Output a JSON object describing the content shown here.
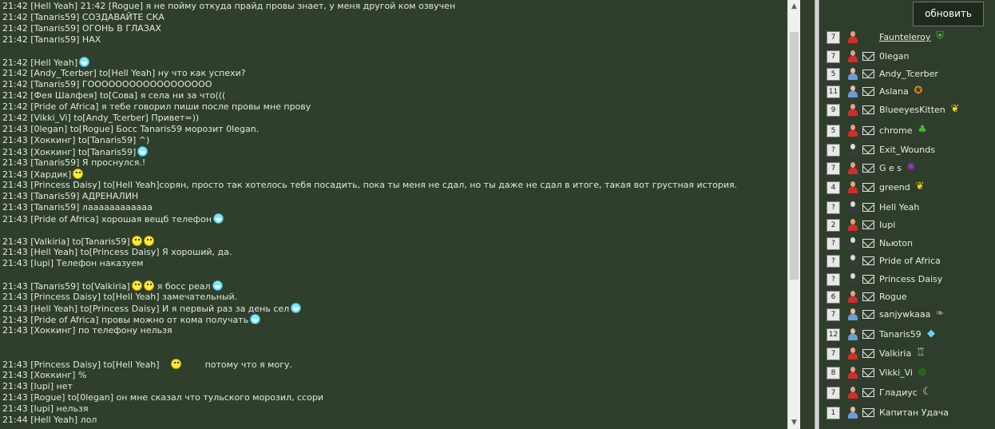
{
  "chat": {
    "lines": [
      {
        "text": "21:42 [Hell Yeah] 21:42 [Rogue] я не пойму откуда прайд провы знает, у меня другой ком озвучен",
        "emo": ""
      },
      {
        "text": "21:42 [Tanaris59] СОЗДАВАЙТЕ СКА",
        "emo": ""
      },
      {
        "text": "21:42 [Tanaris59] ОГОНЬ В ГЛАЗАХ",
        "emo": ""
      },
      {
        "text": "21:42 [Tanaris59] НАХ",
        "emo": ""
      },
      {
        "text": "",
        "emo": ""
      },
      {
        "text": "21:42 [Hell Yeah]",
        "emo": "smile"
      },
      {
        "text": "21:42 [Andy_Tcerber] to[Hell Yeah] ну что как успехи?",
        "emo": ""
      },
      {
        "text": "21:42 [Tanaris59] ГОООООООООООООООООО",
        "emo": ""
      },
      {
        "text": "21:42 [Фея Шалфея] to[Сова] я села ни за что(((",
        "emo": ""
      },
      {
        "text": "21:42 [Pride of Africa] я тебе говорил пиши после провы мне прову",
        "emo": ""
      },
      {
        "text": "21:42 [Vikki_Vi] to[Andy_Tcerber] Привет=))",
        "emo": ""
      },
      {
        "text": "21:43 [0legan] to[Rogue] Босс Tanaris59 морозит 0legan.",
        "emo": ""
      },
      {
        "text": "21:43 [Хоккинг] to[Tanaris59] ^)",
        "emo": ""
      },
      {
        "text": "21:43 [Хоккинг] to[Tanaris59]",
        "emo": "smile"
      },
      {
        "text": "21:43 [Tanaris59] Я проснулся.!",
        "emo": ""
      },
      {
        "text": "21:43 [Хардик]",
        "emo": "yellow"
      },
      {
        "text": "21:43 [Princess Daisy] to[Hell Yeah]сорян, просто так хотелось тебя посадить, пока ты меня не сдал, но ты даже не сдал в итоге, такая вот грустная история.",
        "emo": ""
      },
      {
        "text": "21:43 [Tanaris59] АДРЕНАЛИН",
        "emo": ""
      },
      {
        "text": "21:43 [Tanaris59] лаааааааааааа",
        "emo": ""
      },
      {
        "text": "21:43 [Pride of Africa] хорошая вещб телефон",
        "emo": "smile"
      },
      {
        "text": "",
        "emo": ""
      },
      {
        "text": "21:43 [Valkiria] to[Tanaris59]",
        "emo": "yellow2"
      },
      {
        "text": "21:43 [Hell Yeah] to[Princess Daisy] Я хороший, да.",
        "emo": ""
      },
      {
        "text": "21:43 [Iupi] Телефон наказуем",
        "emo": ""
      },
      {
        "text": "",
        "emo": ""
      },
      {
        "text": "21:43 [Tanaris59] to[Valkiria]",
        "emo": "boss"
      },
      {
        "text": "21:43 [Princess Daisy] to[Hell Yeah] замечательный.",
        "emo": ""
      },
      {
        "text": "21:43 [Hell Yeah] to[Princess Daisy] И я первый раз за день сел",
        "emo": "smile"
      },
      {
        "text": "21:43 [Pride of Africa] провы можно от кома получать",
        "emo": "smile"
      },
      {
        "text": "21:43 [Хоккинг] по телефону нельзя",
        "emo": ""
      },
      {
        "text": "",
        "emo": ""
      },
      {
        "text": "",
        "emo": ""
      },
      {
        "text": "21:43 [Princess Daisy] to[Hell Yeah]",
        "emo": "daisy"
      },
      {
        "text": "21:43 [Хоккинг] %",
        "emo": ""
      },
      {
        "text": "21:43 [Iupi] нет",
        "emo": ""
      },
      {
        "text": "21:43 [Rogue] to[0legan] он мне сказал что тульского морозил, ссори",
        "emo": ""
      },
      {
        "text": "21:43 [Iupi] нельзя",
        "emo": ""
      },
      {
        "text": "21:44 [Hell Yeah] лол",
        "emo": ""
      }
    ],
    "boss_suffix": "я босс реал",
    "daisy_suffix": "потому что я могу."
  },
  "sidebar": {
    "refresh_label": "обновить",
    "users": [
      {
        "level": "7",
        "name": "Faunteleroy",
        "gender": "red",
        "mail": false,
        "link": true,
        "badge": "shield-icon",
        "badge_glyph": "⛨",
        "badge_color": "#3cc84a"
      },
      {
        "level": "7",
        "name": "0legan",
        "gender": "red",
        "mail": true,
        "link": false,
        "badge": "",
        "badge_glyph": "",
        "badge_color": ""
      },
      {
        "level": "5",
        "name": "Andy_Tcerber",
        "gender": "blue",
        "mail": true,
        "link": false,
        "badge": "",
        "badge_glyph": "",
        "badge_color": ""
      },
      {
        "level": "11",
        "name": "Aslana",
        "gender": "blue",
        "mail": true,
        "link": false,
        "badge": "compass-icon",
        "badge_glyph": "✪",
        "badge_color": "#e08a1a"
      },
      {
        "level": "9",
        "name": "BlueeyesKitten",
        "gender": "red",
        "mail": true,
        "link": false,
        "badge": "griffin-icon",
        "badge_glyph": "❦",
        "badge_color": "#f2d21e"
      },
      {
        "level": "5",
        "name": "chrome",
        "gender": "red",
        "mail": true,
        "link": false,
        "badge": "clover-icon",
        "badge_glyph": "♣",
        "badge_color": "#3fc42a"
      },
      {
        "level": "?",
        "name": "Exit_Wounds",
        "gender": "unknown",
        "mail": true,
        "link": false,
        "badge": "",
        "badge_glyph": "",
        "badge_color": ""
      },
      {
        "level": "7",
        "name": "G e s",
        "gender": "red",
        "mail": true,
        "link": false,
        "badge": "spider-icon",
        "badge_glyph": "✺",
        "badge_color": "#9a2fd0"
      },
      {
        "level": "4",
        "name": "greend",
        "gender": "red",
        "mail": true,
        "link": false,
        "badge": "griffin-icon",
        "badge_glyph": "❦",
        "badge_color": "#f2d21e"
      },
      {
        "level": "?",
        "name": "Hell Yeah",
        "gender": "unknown",
        "mail": true,
        "link": false,
        "badge": "",
        "badge_glyph": "",
        "badge_color": ""
      },
      {
        "level": "2",
        "name": "Iupi",
        "gender": "red",
        "mail": true,
        "link": false,
        "badge": "",
        "badge_glyph": "",
        "badge_color": ""
      },
      {
        "level": "?",
        "name": "Nьюton",
        "gender": "unknown",
        "mail": true,
        "link": false,
        "badge": "",
        "badge_glyph": "",
        "badge_color": ""
      },
      {
        "level": "?",
        "name": "Pride of Africa",
        "gender": "unknown",
        "mail": true,
        "link": false,
        "badge": "",
        "badge_glyph": "",
        "badge_color": ""
      },
      {
        "level": "?",
        "name": "Princess Daisy",
        "gender": "unknown",
        "mail": true,
        "link": false,
        "badge": "",
        "badge_glyph": "",
        "badge_color": ""
      },
      {
        "level": "6",
        "name": "Rogue",
        "gender": "red",
        "mail": true,
        "link": false,
        "badge": "",
        "badge_glyph": "",
        "badge_color": ""
      },
      {
        "level": "7",
        "name": "sanjywkaaa",
        "gender": "blue",
        "mail": true,
        "link": false,
        "badge": "eagle-icon",
        "badge_glyph": "❧",
        "badge_color": "#a0968a"
      },
      {
        "level": "12",
        "name": "Tanaris59",
        "gender": "blue",
        "mail": true,
        "link": false,
        "badge": "diamond-icon",
        "badge_glyph": "◆",
        "badge_color": "#5fd6ee"
      },
      {
        "level": "7",
        "name": "Valkiria",
        "gender": "red",
        "mail": true,
        "link": false,
        "badge": "trophy-icon",
        "badge_glyph": "♖",
        "badge_color": "#cfcfcf"
      },
      {
        "level": "8",
        "name": "Vikki_Vi",
        "gender": "red",
        "mail": true,
        "link": false,
        "badge": "orb-icon",
        "badge_glyph": "●",
        "badge_color": "#1f6a1a"
      },
      {
        "level": "7",
        "name": "Гладиус",
        "gender": "red",
        "mail": true,
        "link": false,
        "badge": "moon-icon",
        "badge_glyph": "☾",
        "badge_color": "#f3e27a"
      },
      {
        "level": "1",
        "name": "Капитан Удача",
        "gender": "blue",
        "mail": true,
        "link": false,
        "badge": "",
        "badge_glyph": "",
        "badge_color": ""
      }
    ]
  }
}
